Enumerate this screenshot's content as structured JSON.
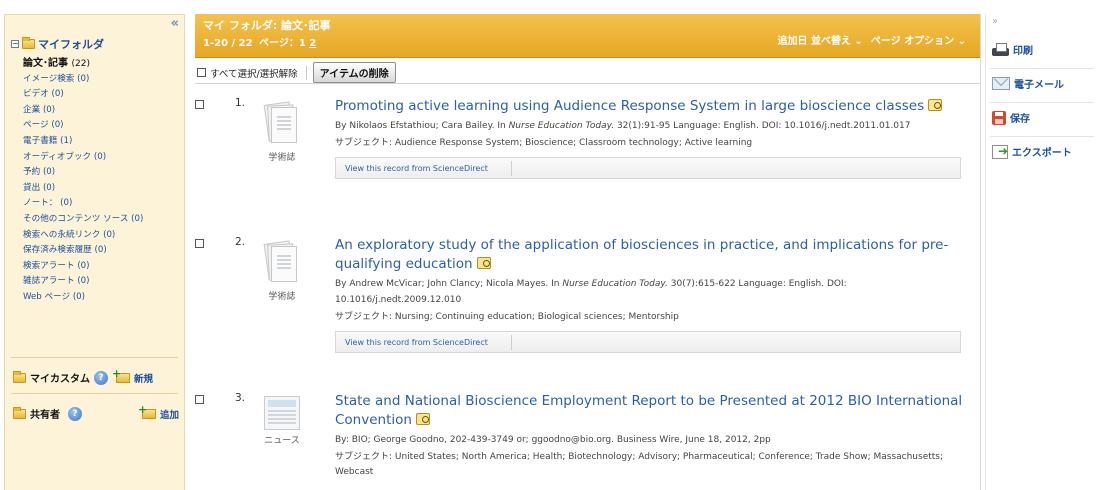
{
  "sidebar": {
    "collapse_glyph": "«",
    "folder_title": "マイフォルダ",
    "categories": [
      {
        "label": "論文･記事",
        "count": "(22)"
      },
      {
        "label": "イメージ検索",
        "count": "(0)"
      },
      {
        "label": "ビデオ",
        "count": "(0)"
      },
      {
        "label": "企業",
        "count": "(0)"
      },
      {
        "label": "ページ",
        "count": "(0)"
      },
      {
        "label": "電子書籍",
        "count": "(1)"
      },
      {
        "label": "オーディオブック",
        "count": "(0)"
      },
      {
        "label": "予約",
        "count": "(0)"
      },
      {
        "label": "貸出",
        "count": "(0)"
      },
      {
        "label": "ノート：",
        "count": "(0)"
      },
      {
        "label": "その他のコンテンツ ソース",
        "count": "(0)"
      },
      {
        "label": "検索への永続リンク",
        "count": "(0)"
      },
      {
        "label": "保存済み検索履歴",
        "count": "(0)"
      },
      {
        "label": "検索アラート",
        "count": "(0)"
      },
      {
        "label": "雑誌アラート",
        "count": "(0)"
      },
      {
        "label": "Web ページ",
        "count": "(0)"
      }
    ],
    "my_custom_label": "マイカスタム",
    "new_link": "新規",
    "shared_label": "共有者",
    "add_link": "追加",
    "help_glyph": "?"
  },
  "header": {
    "title": "マイ フォルダ: 論文･記事",
    "range": "1-20 / 22",
    "page_label": "ページ：1",
    "page_2": "2",
    "sort_label": "追加日 並べ替え",
    "page_options": "ページ オプション",
    "dropdown_glyph": "⌄"
  },
  "toolbar": {
    "select_all": "すべて選択/選択解除",
    "delete_button": "アイテムの削除"
  },
  "results": [
    {
      "number": "1.",
      "type": "学術誌",
      "title": "Promoting active learning using Audience Response System in large bioscience classes",
      "meta_prefix": "By Nikolaos Efstathiou; Cara Bailey. In ",
      "journal": "Nurse Education Today.",
      "meta_suffix": " 32(1):91-95 Language: English. DOI: 10.1016/j.nedt.2011.01.017",
      "subjects": "サブジェクト: Audience Response System; Bioscience; Classroom technology; Active learning",
      "access_link": "View this record from ScienceDirect"
    },
    {
      "number": "2.",
      "type": "学術誌",
      "title": "An exploratory study of the application of biosciences in practice, and implications for pre-qualifying education",
      "meta_prefix": "By Andrew McVicar; John Clancy; Nicola Mayes. In ",
      "journal": "Nurse Education Today.",
      "meta_suffix": " 30(7):615-622 Language: English. DOI: 10.1016/j.nedt.2009.12.010",
      "subjects": "サブジェクト: Nursing; Continuing education; Biological sciences; Mentorship",
      "access_link": "View this record from ScienceDirect"
    },
    {
      "number": "3.",
      "type": "ニュース",
      "title": "State and National Bioscience Employment Report to be Presented at 2012 BIO International Convention",
      "meta_prefix": "By: BIO; George Goodno, 202-439-3749 or; ggoodno@bio.org. Business Wire, June 18, 2012, 2pp",
      "journal": "",
      "meta_suffix": "",
      "subjects": "サブジェクト: United States; North America; Health; Biotechnology; Advisory; Pharmaceutical; Conference; Trade Show; Massachusetts; Webcast"
    }
  ],
  "tools": {
    "expand_glyph": "»",
    "print": "印刷",
    "email": "電子メール",
    "save": "保存",
    "export": "エクスポート"
  }
}
